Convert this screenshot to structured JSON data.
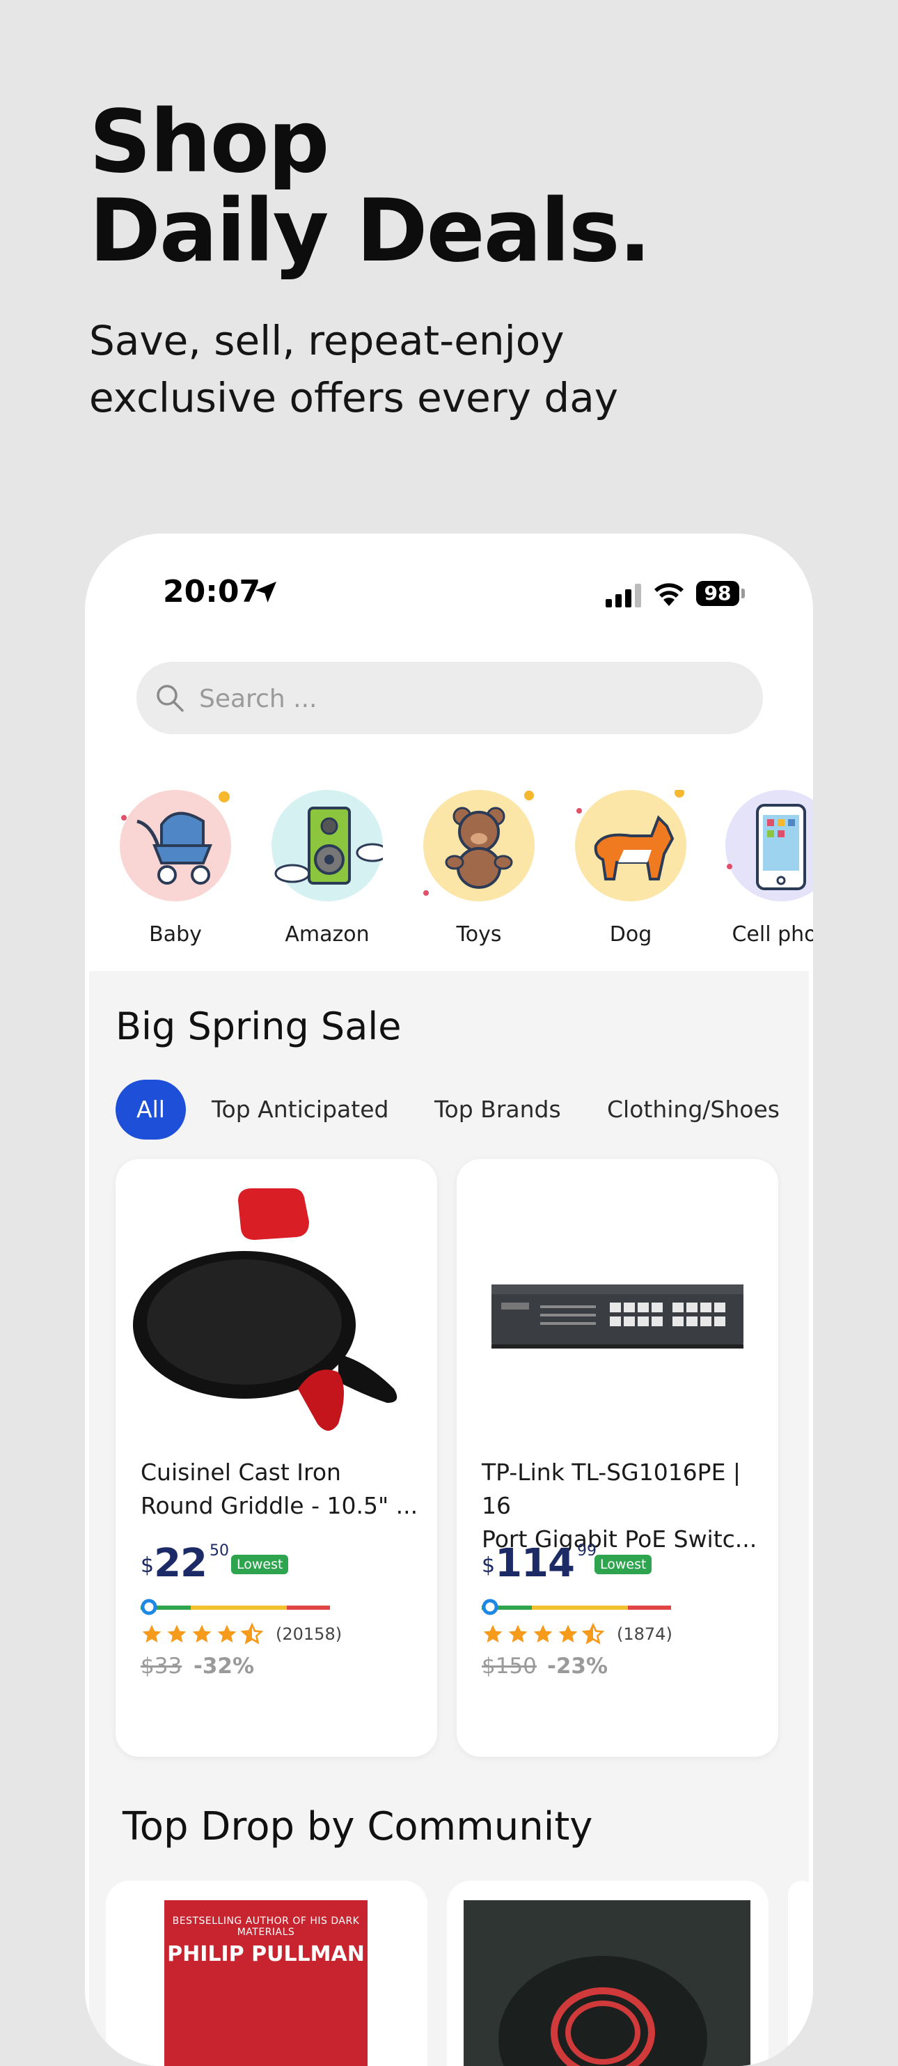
{
  "hero": {
    "title_line1": "Shop",
    "title_line2": "Daily Deals.",
    "subtitle_line1": "Save, sell, repeat-enjoy",
    "subtitle_line2": "exclusive offers every day"
  },
  "status_bar": {
    "time": "20:07",
    "battery": "98",
    "icons": [
      "location-arrow-icon",
      "cellular-signal-icon",
      "wifi-icon",
      "battery-icon"
    ]
  },
  "search": {
    "placeholder": "Search ..."
  },
  "categories": [
    {
      "label": "Baby",
      "icon": "stroller-icon",
      "color": "#f9d6d3"
    },
    {
      "label": "Amazon",
      "icon": "speaker-icon",
      "color": "#d6f1f1"
    },
    {
      "label": "Toys",
      "icon": "teddy-bear-icon",
      "color": "#fbe6a8"
    },
    {
      "label": "Dog",
      "icon": "corgi-icon",
      "color": "#fbe6a8"
    },
    {
      "label": "Cell phon",
      "icon": "cell-phone-icon",
      "color": "#e4e3fa"
    }
  ],
  "sale": {
    "title": "Big Spring Sale",
    "chips": [
      "All",
      "Top Anticipated",
      "Top Brands",
      "Clothing/Shoes"
    ],
    "active_chip": "All"
  },
  "products": [
    {
      "title_line1": "Cuisinel Cast Iron",
      "title_line2": "Round Griddle - 10.5\" ...",
      "currency": "$",
      "price_whole": "22",
      "price_cents": "50",
      "badge": "Lowest",
      "stars": 4.5,
      "rating_count": "(20158)",
      "old_price": "$33",
      "discount": "-32%"
    },
    {
      "title_line1": "TP-Link TL-SG1016PE | 16",
      "title_line2": "Port Gigabit PoE Switc...",
      "currency": "$",
      "price_whole": "114",
      "price_cents": "99",
      "badge": "Lowest",
      "stars": 4.5,
      "rating_count": "(1874)",
      "old_price": "$150",
      "discount": "-23%"
    }
  ],
  "community": {
    "title": "Top Drop by Community",
    "book_top_line": "BESTSELLING AUTHOR OF HIS DARK MATERIALS",
    "book_author": "PHILIP PULLMAN"
  },
  "colors": {
    "accent": "#1e4fd8",
    "price": "#1c2a66",
    "badge": "#2ea44f",
    "star": "#f59a1b"
  }
}
